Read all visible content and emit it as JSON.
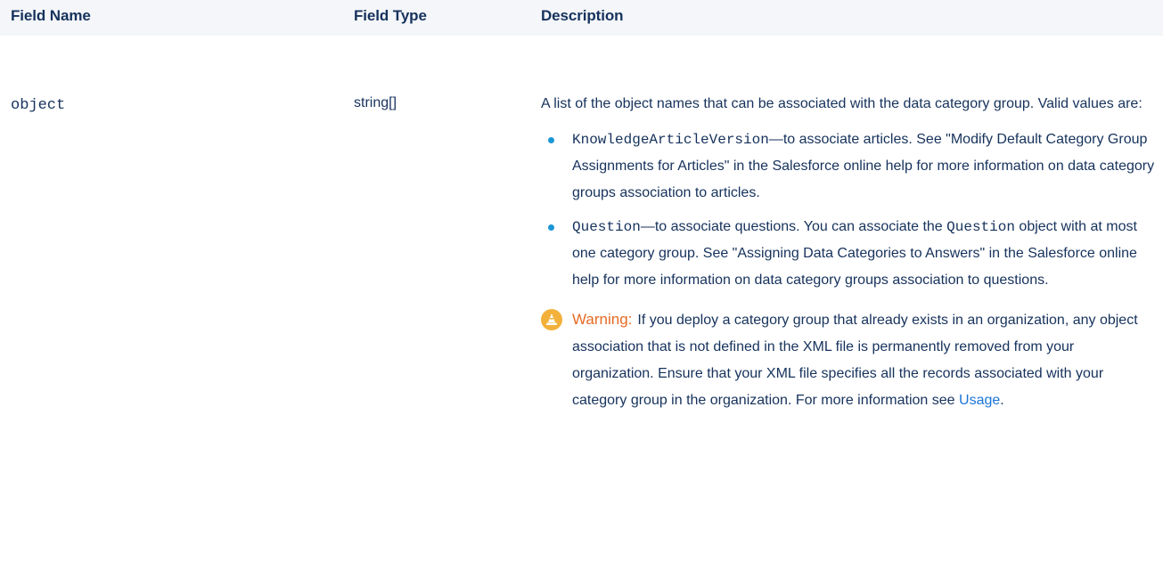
{
  "table": {
    "headers": {
      "field_name": "Field Name",
      "field_type": "Field Type",
      "description": "Description"
    },
    "row": {
      "field_name": "object",
      "field_type": "string[]",
      "description_intro": "A list of the object names that can be associated with the data category group. Valid values are:",
      "values": [
        {
          "code": "KnowledgeArticleVersion",
          "text": "—to associate articles. See \"Modify Default Category Group Assignments for Articles\" in the Salesforce online help for more information on data category groups association to articles."
        },
        {
          "code": "Question",
          "text_a": "—to associate questions. You can associate the ",
          "code_b": "Question",
          "text_b": " object with at most one category group. See \"Assigning Data Categories to Answers\" in the Salesforce online help for more information on data category groups association to questions."
        }
      ],
      "warning": {
        "label": "Warning:",
        "text": "If you deploy a category group that already exists in an organization, any object association that is not defined in the XML file is permanently removed from your organization. Ensure that your XML file specifies all the records associated with your category group in the organization. For more information see ",
        "link": "Usage",
        "after_link": "."
      }
    }
  },
  "colors": {
    "text": "#16325c",
    "header_bg": "#f4f6f9",
    "bullet": "#1b96d6",
    "warning_label": "#e56a23",
    "warning_icon": "#f2b13a",
    "link": "#1b74d6"
  },
  "icons": {
    "warning": "warning-cone-icon"
  }
}
